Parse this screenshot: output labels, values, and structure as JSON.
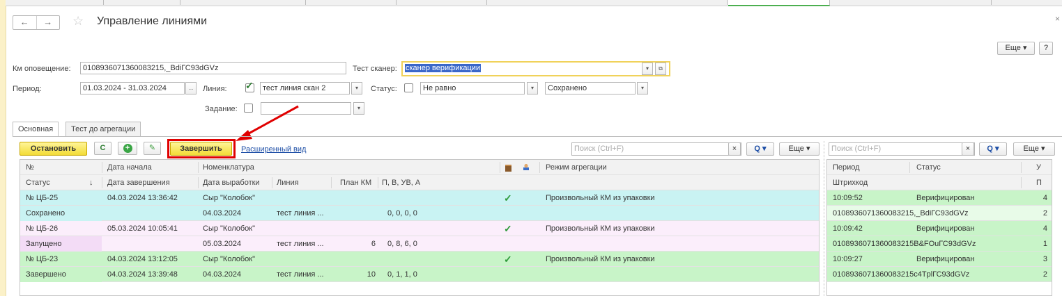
{
  "window": {
    "title": "Управление линиями",
    "back_glyph": "←",
    "forward_glyph": "→",
    "star_glyph": "☆",
    "close_glyph": "×"
  },
  "toolbar_top": {
    "more_label": "Еще",
    "help_label": "?"
  },
  "filters": {
    "km_label": "Км оповещение:",
    "km_value": "0108936071360083215,_BdiГС93dGVz",
    "scanner_label": "Тест сканер:",
    "scanner_value": "сканер верификации",
    "period_label": "Период:",
    "period_value": "01.03.2024 - 31.03.2024",
    "line_label": "Линия:",
    "line_checked": true,
    "line_value": "тест линия скан 2",
    "status_label": "Статус:",
    "status_condition": "Не равно",
    "status_value": "Сохранено",
    "task_label": "Задание:",
    "task_value": ""
  },
  "form_tabs": [
    {
      "label": "Основная",
      "active": true
    },
    {
      "label": "Тест до агрегации",
      "active": false
    }
  ],
  "actions": {
    "stop_label": "Остановить",
    "refresh_glyph": "C",
    "add_glyph": "+",
    "edit_glyph": "✎",
    "finish_label": "Завершить",
    "extended_view_label": "Расширенный вид",
    "search_placeholder": "Поиск (Ctrl+F)",
    "search_clear": "×",
    "search_glyph": "Q",
    "more_label": "Еще"
  },
  "main_table": {
    "header1": [
      "№",
      "Дата начала",
      "Номенклатура",
      "",
      "",
      "Режим агрегации"
    ],
    "header2": [
      "Статус",
      "Дата завершения",
      "Дата выработки",
      "Линия",
      "План КМ",
      "П, В, УВ, А"
    ],
    "sort_glyph": "↓",
    "rows": [
      {
        "num": "№ ЦБ-25",
        "start": "04.03.2024 13:36:42",
        "nom": "Сыр \"Колобок\"",
        "mode": "Произвольный КМ из упаковки",
        "status": "Сохранено",
        "end": "",
        "prod_date": "04.03.2024",
        "line": "тест линия ...",
        "plan": "",
        "counts": "0, 0, 0, 0",
        "color": "#c9f3f3",
        "status_color": "#c9f3f3",
        "check": "✓"
      },
      {
        "num": "№ ЦБ-26",
        "start": "05.03.2024 10:05:41",
        "nom": "Сыр \"Колобок\"",
        "mode": "Произвольный КМ из упаковки",
        "status": "Запущено",
        "end": "",
        "prod_date": "05.03.2024",
        "line": "тест линия ...",
        "plan": "6",
        "counts": "0, 8, 6, 0",
        "color": "#fbeefb",
        "status_color": "#f3dcf6",
        "check": "✓"
      },
      {
        "num": "№ ЦБ-23",
        "start": "04.03.2024 13:12:05",
        "nom": "Сыр \"Колобок\"",
        "mode": "Произвольный КМ из упаковки",
        "status": "Завершено",
        "end": "04.03.2024 13:39:48",
        "prod_date": "04.03.2024",
        "line": "тест линия ...",
        "plan": "10",
        "counts": "0, 1, 1, 0",
        "color": "#c8f4c8",
        "status_color": "#c8f4c8",
        "check": "✓"
      }
    ]
  },
  "side_table": {
    "search_placeholder": "Поиск (Ctrl+F)",
    "search_clear": "×",
    "search_glyph": "Q",
    "more_label": "Еще",
    "header1": [
      "Период",
      "Статус",
      "У"
    ],
    "header2": [
      "Штрихкод",
      "П"
    ],
    "rows": [
      {
        "time": "10:09:52",
        "status": "Верифицирован",
        "u": "4",
        "code": "0108936071360083215,_BdiГС93dGVz",
        "p": "2"
      },
      {
        "time": "10:09:42",
        "status": "Верифицирован",
        "u": "4",
        "code": "0108936071360083215B&FOuГС93dGVz",
        "p": "1"
      },
      {
        "time": "10:09:27",
        "status": "Верифицирован",
        "u": "3",
        "code": "0108936071360083215c4TplГС93dGVz",
        "p": "2"
      }
    ]
  },
  "colors": {
    "accent_yellow": "#f3dc36",
    "highlight_red": "#e00000",
    "row_cyan": "#c9f3f3",
    "row_pink": "#fbeefb",
    "row_green": "#c8f4c8"
  }
}
